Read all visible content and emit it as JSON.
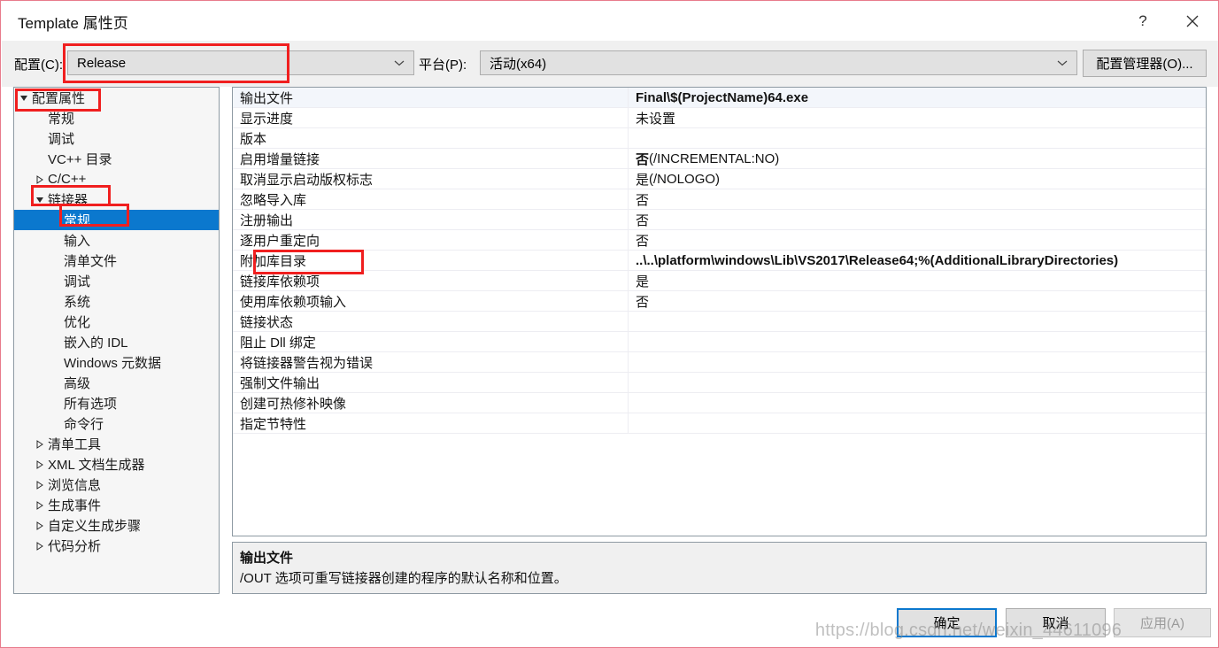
{
  "window": {
    "title": "Template 属性页",
    "help_icon": "question-mark-icon",
    "close_icon": "close-icon"
  },
  "config_bar": {
    "configuration_label": "配置(C):",
    "configuration_value": "Release",
    "platform_label": "平台(P):",
    "platform_value": "活动(x64)",
    "config_manager_button": "配置管理器(O)...",
    "dropdown_icon": "chevron-down-icon"
  },
  "tree": {
    "items": [
      {
        "label": "配置属性",
        "depth": 0,
        "expander": "expanded",
        "selected": false
      },
      {
        "label": "常规",
        "depth": 1,
        "expander": "none",
        "selected": false
      },
      {
        "label": "调试",
        "depth": 1,
        "expander": "none",
        "selected": false
      },
      {
        "label": "VC++ 目录",
        "depth": 1,
        "expander": "none",
        "selected": false
      },
      {
        "label": "C/C++",
        "depth": 1,
        "expander": "collapsed",
        "selected": false
      },
      {
        "label": "链接器",
        "depth": 1,
        "expander": "expanded",
        "selected": false
      },
      {
        "label": "常规",
        "depth": 2,
        "expander": "none",
        "selected": true
      },
      {
        "label": "输入",
        "depth": 2,
        "expander": "none",
        "selected": false
      },
      {
        "label": "清单文件",
        "depth": 2,
        "expander": "none",
        "selected": false
      },
      {
        "label": "调试",
        "depth": 2,
        "expander": "none",
        "selected": false
      },
      {
        "label": "系统",
        "depth": 2,
        "expander": "none",
        "selected": false
      },
      {
        "label": "优化",
        "depth": 2,
        "expander": "none",
        "selected": false
      },
      {
        "label": "嵌入的 IDL",
        "depth": 2,
        "expander": "none",
        "selected": false
      },
      {
        "label": "Windows 元数据",
        "depth": 2,
        "expander": "none",
        "selected": false
      },
      {
        "label": "高级",
        "depth": 2,
        "expander": "none",
        "selected": false
      },
      {
        "label": "所有选项",
        "depth": 2,
        "expander": "none",
        "selected": false
      },
      {
        "label": "命令行",
        "depth": 2,
        "expander": "none",
        "selected": false
      },
      {
        "label": "清单工具",
        "depth": 1,
        "expander": "collapsed",
        "selected": false
      },
      {
        "label": "XML 文档生成器",
        "depth": 1,
        "expander": "collapsed",
        "selected": false
      },
      {
        "label": "浏览信息",
        "depth": 1,
        "expander": "collapsed",
        "selected": false
      },
      {
        "label": "生成事件",
        "depth": 1,
        "expander": "collapsed",
        "selected": false
      },
      {
        "label": "自定义生成步骤",
        "depth": 1,
        "expander": "collapsed",
        "selected": false
      },
      {
        "label": "代码分析",
        "depth": 1,
        "expander": "collapsed",
        "selected": false
      }
    ]
  },
  "grid": {
    "rows": [
      {
        "name": "输出文件",
        "value": "Final\\$(ProjectName)64.exe",
        "suffix": "",
        "modified": true,
        "selected": true
      },
      {
        "name": "显示进度",
        "value": "未设置",
        "suffix": "",
        "modified": false,
        "selected": false
      },
      {
        "name": "版本",
        "value": "",
        "suffix": "",
        "modified": false,
        "selected": false
      },
      {
        "name": "启用增量链接",
        "value": "否",
        "suffix": " (/INCREMENTAL:NO)",
        "modified": true,
        "selected": false
      },
      {
        "name": "取消显示启动版权标志",
        "value": "是",
        "suffix": " (/NOLOGO)",
        "modified": false,
        "selected": false
      },
      {
        "name": "忽略导入库",
        "value": "否",
        "suffix": "",
        "modified": false,
        "selected": false
      },
      {
        "name": "注册输出",
        "value": "否",
        "suffix": "",
        "modified": false,
        "selected": false
      },
      {
        "name": "逐用户重定向",
        "value": "否",
        "suffix": "",
        "modified": false,
        "selected": false
      },
      {
        "name": "附加库目录",
        "value": "..\\..\\platform\\windows\\Lib\\VS2017\\Release64;%(AdditionalLibraryDirectories)",
        "suffix": "",
        "modified": true,
        "selected": false
      },
      {
        "name": "链接库依赖项",
        "value": "是",
        "suffix": "",
        "modified": false,
        "selected": false
      },
      {
        "name": "使用库依赖项输入",
        "value": "否",
        "suffix": "",
        "modified": false,
        "selected": false
      },
      {
        "name": "链接状态",
        "value": "",
        "suffix": "",
        "modified": false,
        "selected": false
      },
      {
        "name": "阻止 Dll 绑定",
        "value": "",
        "suffix": "",
        "modified": false,
        "selected": false
      },
      {
        "name": "将链接器警告视为错误",
        "value": "",
        "suffix": "",
        "modified": false,
        "selected": false
      },
      {
        "name": "强制文件输出",
        "value": "",
        "suffix": "",
        "modified": false,
        "selected": false
      },
      {
        "name": "创建可热修补映像",
        "value": "",
        "suffix": "",
        "modified": false,
        "selected": false
      },
      {
        "name": "指定节特性",
        "value": "",
        "suffix": "",
        "modified": false,
        "selected": false
      }
    ]
  },
  "description": {
    "title": "输出文件",
    "body": "/OUT 选项可重写链接器创建的程序的默认名称和位置。"
  },
  "footer": {
    "ok": "确定",
    "cancel": "取消",
    "apply": "应用(A)"
  },
  "annotations": {
    "accent_red": "#f01f1f",
    "selection_blue": "#0b78ce"
  },
  "watermark": {
    "text": "https://blog.csdn.net/weixin_44611096"
  }
}
